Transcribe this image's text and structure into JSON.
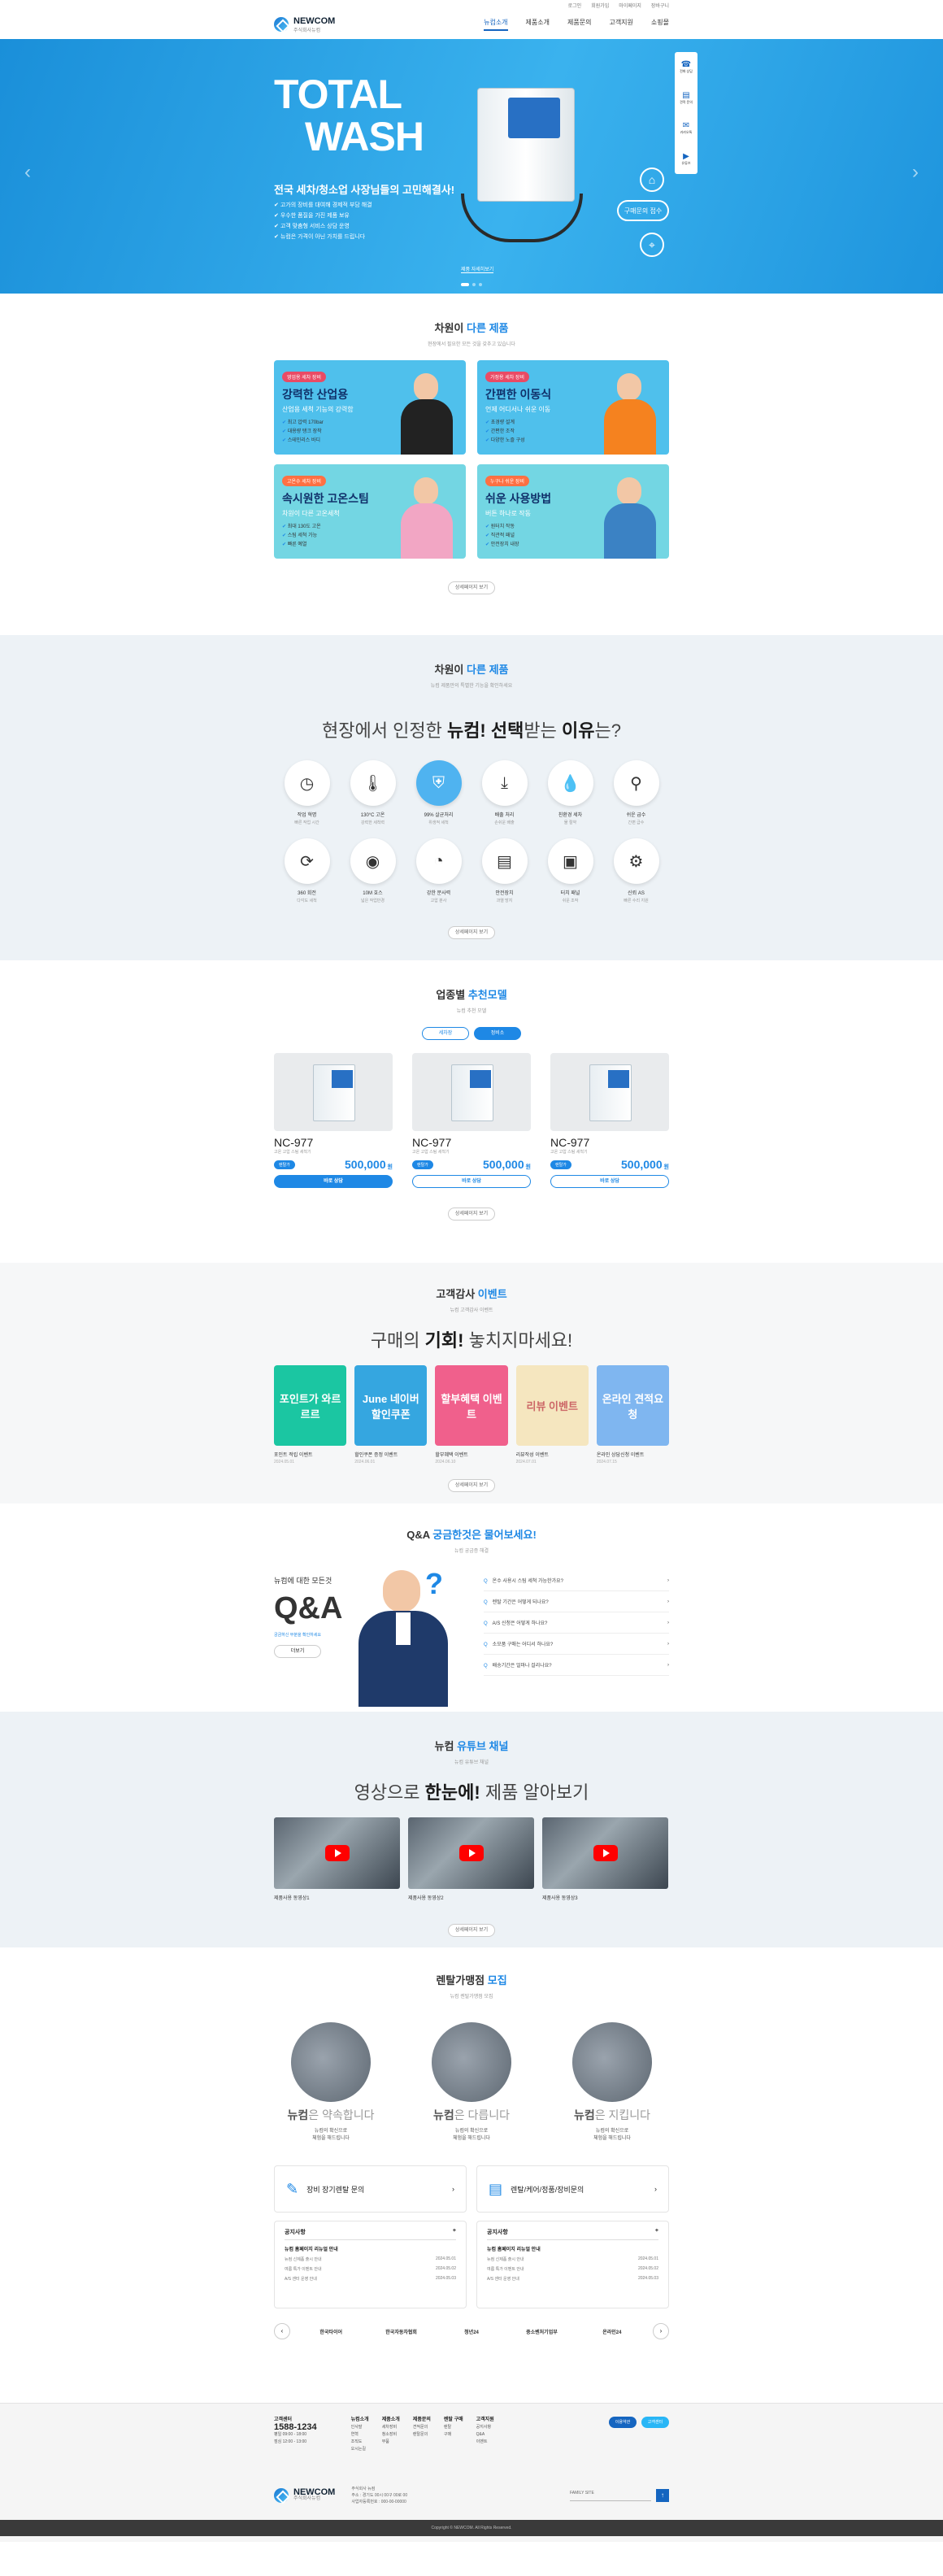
{
  "util": [
    "로그인",
    "회원가입",
    "마이페이지",
    "장바구니"
  ],
  "logo": {
    "name": "NEWCOM",
    "sub": "주식회사뉴컴"
  },
  "menu": [
    "뉴컴소개",
    "제품소개",
    "제품문의",
    "고객지원",
    "쇼핑몰"
  ],
  "hero": {
    "line1": "TOTAL",
    "line2": "WASH",
    "sub": "전국 세차/청소업 사장님들의 고민해결사!",
    "points": [
      "고가의 장비를 대여해 경제적 부담 해결",
      "우수한 품질을 가진 제품 보유",
      "고객 맞춤형 서비스 상담 운영",
      "뉴컴은 가격이 아닌 가치를 드립니다"
    ],
    "more": "제품 자세히보기",
    "buy": "구매문의 접수",
    "quick": [
      "전화 상담",
      "견적 문의",
      "카카오톡",
      "유튜브"
    ]
  },
  "products": {
    "title_a": "차원이",
    "title_b": "다른 제품",
    "desc": "현장에서 필요한 모든 것을 갖추고 있습니다",
    "cards": [
      {
        "tag": "영업용 세차 장비",
        "title": "강력한 산업용",
        "sub": "산업용 세척 기능의 강력함",
        "items": [
          "최고 압력 170bar",
          "대용량 탱크 장착",
          "스테인리스 바디"
        ],
        "bg": "#4fc0ec"
      },
      {
        "tag": "가정용 세차 장비",
        "title": "간편한 이동식",
        "sub": "언제 어디서나 쉬운 이동",
        "items": [
          "초경량 설계",
          "간편한 조작",
          "다양한 노즐 구성"
        ],
        "bg": "#4fc0ec"
      },
      {
        "tag": "고온수 세차 장비",
        "title": "속시원한 고온스팀",
        "sub": "차원이 다른 고온세척",
        "items": [
          "최대 130도 고온",
          "스팀 세척 가능",
          "빠른 예열"
        ],
        "bg": "#73d6e3"
      },
      {
        "tag": "누구나 쉬운 장비",
        "title": "쉬운 사용방법",
        "sub": "버튼 하나로 작동",
        "items": [
          "원터치 작동",
          "직관적 패널",
          "안전장치 내장"
        ],
        "bg": "#73d6e3"
      }
    ],
    "more": "상세페이지 보기"
  },
  "features": {
    "title_a": "차원이",
    "title_b": "다른 제품",
    "desc": "뉴컴 제품만의 특별한 기능을 확인하세요",
    "head_a": "현장에서 인정한",
    "head_b": "뉴컴!",
    "head_c": "선택",
    "head_d": "받는",
    "head_e": "이유",
    "head_f": "는?",
    "items": [
      {
        "icon": "clock-icon",
        "glyph": "◷",
        "name": "작업 혁명",
        "desc": "빠른 작업 시간"
      },
      {
        "icon": "thermometer-icon",
        "glyph": "🌡",
        "name": "130°C 고온",
        "desc": "강력한 세척력"
      },
      {
        "icon": "shield-icon",
        "glyph": "⛨",
        "name": "99% 살균처리",
        "desc": "위생적 세척",
        "hl": true
      },
      {
        "icon": "download-icon",
        "glyph": "⤓",
        "name": "배출 처리",
        "desc": "손쉬운 배출"
      },
      {
        "icon": "drop-icon",
        "glyph": "💧",
        "name": "친환경 세차",
        "desc": "물 절약"
      },
      {
        "icon": "faucet-icon",
        "glyph": "⚲",
        "name": "쉬운 급수",
        "desc": "간편 급수"
      },
      {
        "icon": "rotate-icon",
        "glyph": "⟳",
        "name": "360 회전",
        "desc": "다각도 세척"
      },
      {
        "icon": "hose-icon",
        "glyph": "◉",
        "name": "10M 호스",
        "desc": "넓은 작업반경"
      },
      {
        "icon": "gauge-icon",
        "glyph": "◔",
        "name": "강한 분사력",
        "desc": "고압 분사"
      },
      {
        "icon": "file-icon",
        "glyph": "▤",
        "name": "안전장치",
        "desc": "과열 방지"
      },
      {
        "icon": "panel-icon",
        "glyph": "▣",
        "name": "터치 패널",
        "desc": "쉬운 조작"
      },
      {
        "icon": "gear-icon",
        "glyph": "⚙",
        "name": "신뢰 AS",
        "desc": "빠른 수리 지원"
      }
    ],
    "more": "상세페이지 보기"
  },
  "recommend": {
    "title_a": "업종별",
    "title_b": "추천모델",
    "desc": "뉴컴 추천 모델",
    "tabs": [
      "세차장",
      "정비소"
    ],
    "items": [
      {
        "name": "NC-977",
        "desc": "고온 고압 스팀 세척기",
        "badge": "렌탈가",
        "price": "500,000",
        "unit": "원",
        "btn": "바로 상담"
      },
      {
        "name": "NC-977",
        "desc": "고온 고압 스팀 세척기",
        "badge": "렌탈가",
        "price": "500,000",
        "unit": "원",
        "btn": "바로 상담"
      },
      {
        "name": "NC-977",
        "desc": "고온 고압 스팀 세척기",
        "badge": "렌탈가",
        "price": "500,000",
        "unit": "원",
        "btn": "바로 상담"
      }
    ],
    "more": "상세페이지 보기"
  },
  "events": {
    "title_a": "고객감사",
    "title_b": "이벤트",
    "desc": "뉴컴 고객감사 이벤트",
    "head_a": "구매의",
    "head_b": "기회!",
    "head_c": "놓치지마세요!",
    "items": [
      {
        "label": "포인트가 와르르르",
        "title": "포인트 적립 이벤트",
        "date": "2024.05.01",
        "bg": "#1bc6a2"
      },
      {
        "label": "June 네이버 할인쿠폰",
        "title": "할인쿠폰 증정 이벤트",
        "date": "2024.06.01",
        "bg": "#35a6e0"
      },
      {
        "label": "할부혜택 이벤트",
        "title": "할부혜택 이벤트",
        "date": "2024.06.10",
        "bg": "#f0608c"
      },
      {
        "label": "리뷰 이벤트",
        "title": "리뷰작성 이벤트",
        "date": "2024.07.01",
        "bg": "#f5e6bf"
      },
      {
        "label": "온라인 견적요청",
        "title": "온라인 상담신청 이벤트",
        "date": "2024.07.15",
        "bg": "#7fb6f0"
      }
    ],
    "more": "상세페이지 보기"
  },
  "qna": {
    "title_a": "Q&A",
    "title_b": "궁금한것은 물어보세요!",
    "desc": "뉴컴 궁금증 해결",
    "s1": "뉴컴에 대한 모든것",
    "big": "Q&A",
    "s2": "궁금하신 부분을 확인하세요",
    "more": "더보기",
    "items": [
      "온수 사용시 스팀 세척 가능한가요?",
      "렌탈 기간은 어떻게 되나요?",
      "A/S 신청은 어떻게 하나요?",
      "소모품 구매는 어디서 하나요?",
      "배송기간은 얼마나 걸리나요?"
    ]
  },
  "videos": {
    "title_a": "뉴컴",
    "title_b": "유튜브 채널",
    "desc": "뉴컴 유튜브 채널",
    "head_a": "영상으로",
    "head_b": "한눈에!",
    "head_c": "제품 알아보기",
    "items": [
      "제품사용 동영상1",
      "제품사용 동영상2",
      "제품사용 동영상3"
    ],
    "more": "상세페이지 보기"
  },
  "rental": {
    "title_a": "렌탈가맹점",
    "title_b": "모집",
    "desc": "뉴컴 렌탈가맹점 모집",
    "items": [
      {
        "a": "뉴컴",
        "b": "은 약속합니다",
        "d1": "뉴컴의 확신으로",
        "d2": "체험을 해드립니다"
      },
      {
        "a": "뉴컴",
        "b": "은 다릅니다",
        "d1": "뉴컴의 확신으로",
        "d2": "체험을 해드립니다"
      },
      {
        "a": "뉴컴",
        "b": "은 지킵니다",
        "d1": "뉴컴의 확신으로",
        "d2": "체험을 해드립니다"
      }
    ],
    "inq1": "장비 장기렌탈 문의",
    "inq2": "렌탈/케어/정품/장비문의"
  },
  "notices": [
    {
      "head": "공지사항",
      "big": "뉴컴 홈페이지 리뉴얼 안내",
      "rows": [
        [
          "뉴컴 신제품 출시 안내",
          "2024.05.01"
        ],
        [
          "여름 특가 이벤트 안내",
          "2024.05.02"
        ],
        [
          "A/S 센터 운영 안내",
          "2024.05.03"
        ]
      ]
    },
    {
      "head": "공지사항",
      "big": "뉴컴 홈페이지 리뉴얼 안내",
      "rows": [
        [
          "뉴컴 신제품 출시 안내",
          "2024.05.01"
        ],
        [
          "여름 특가 이벤트 안내",
          "2024.05.02"
        ],
        [
          "A/S 센터 운영 안내",
          "2024.05.03"
        ]
      ]
    }
  ],
  "partners": [
    "한국타이어",
    "한국자동차협회",
    "청년24",
    "중소벤처기업부",
    "온라인24"
  ],
  "footer": {
    "cs_label": "고객센터",
    "phone": "1588-1234",
    "hours1": "평일 09:00 - 18:00",
    "hours2": "점심 12:00 - 13:00",
    "cols": [
      {
        "t": "뉴컴소개",
        "i": [
          "인사말",
          "연혁",
          "조직도",
          "오시는길"
        ]
      },
      {
        "t": "제품소개",
        "i": [
          "세차장비",
          "청소장비",
          "부품"
        ]
      },
      {
        "t": "제품문의",
        "i": [
          "견적문의",
          "렌탈문의"
        ]
      },
      {
        "t": "렌탈 구매",
        "i": [
          "렌탈",
          "구매"
        ]
      },
      {
        "t": "고객지원",
        "i": [
          "공지사항",
          "Q&A",
          "이벤트"
        ]
      }
    ],
    "btn1": "이용약관",
    "btn2": "고객센터",
    "company": "주식회사 뉴컴",
    "addr": "주소 : 경기도 00시 00구 00로 00",
    "biz": "사업자등록번호 : 000-00-00000",
    "family": "FAMILY SITE",
    "copyright": "Copyright © NEWCOM. All Rights Reserved."
  }
}
